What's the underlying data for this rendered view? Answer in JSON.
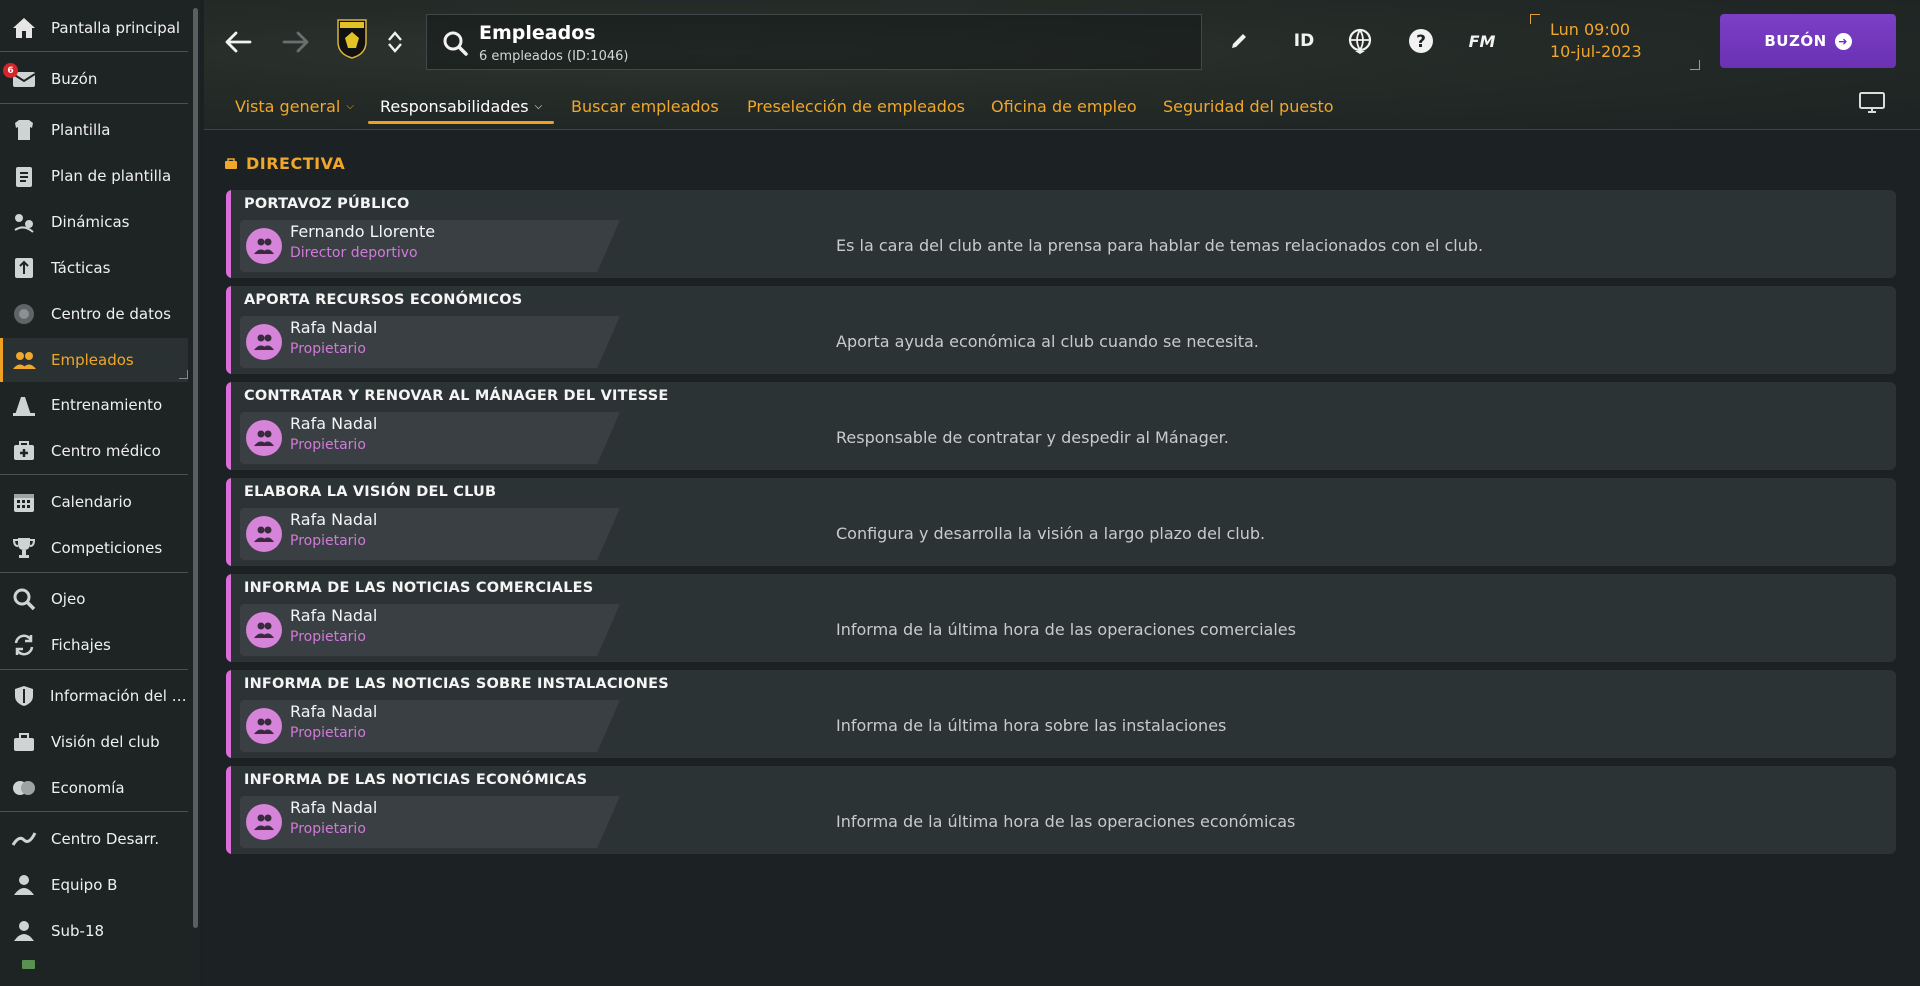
{
  "sidebar": {
    "items": [
      {
        "label": "Pantalla principal",
        "icon": "home-icon"
      },
      {
        "label": "Buzón",
        "icon": "inbox-icon",
        "badge": "6"
      },
      {
        "label": "Plantilla",
        "icon": "shirt-icon"
      },
      {
        "label": "Plan de plantilla",
        "icon": "clipboard-icon"
      },
      {
        "label": "Dinámicas",
        "icon": "dynamics-icon"
      },
      {
        "label": "Tácticas",
        "icon": "tactics-icon"
      },
      {
        "label": "Centro de datos",
        "icon": "data-center-icon"
      },
      {
        "label": "Empleados",
        "icon": "staff-icon"
      },
      {
        "label": "Entrenamiento",
        "icon": "training-icon"
      },
      {
        "label": "Centro médico",
        "icon": "medical-icon"
      },
      {
        "label": "Calendario",
        "icon": "calendar-icon"
      },
      {
        "label": "Competiciones",
        "icon": "trophy-icon"
      },
      {
        "label": "Ojeo",
        "icon": "scouting-icon"
      },
      {
        "label": "Fichajes",
        "icon": "transfers-icon"
      },
      {
        "label": "Información del club",
        "icon": "club-info-icon"
      },
      {
        "label": "Visión del club",
        "icon": "club-vision-icon"
      },
      {
        "label": "Economía",
        "icon": "finances-icon"
      },
      {
        "label": "Centro Desarr.",
        "icon": "development-icon"
      },
      {
        "label": "Equipo B",
        "icon": "b-team-icon"
      },
      {
        "label": "Sub-18",
        "icon": "u18-icon"
      }
    ]
  },
  "header": {
    "title": "Empleados",
    "subtitle": "6 empleados (ID:1046)",
    "id_label": "ID",
    "fm_label": "FM",
    "date_line1": "Lun 09:00",
    "date_line2": "10-jul-2023",
    "inbox_label": "BUZÓN",
    "tabs": [
      {
        "label": "Vista general",
        "dropdown": true
      },
      {
        "label": "Responsabilidades",
        "dropdown": true
      },
      {
        "label": "Buscar empleados"
      },
      {
        "label": "Preselección de empleados"
      },
      {
        "label": "Oficina de empleo"
      },
      {
        "label": "Seguridad del puesto"
      }
    ]
  },
  "main": {
    "section_title": "DIRECTIVA",
    "cards": [
      {
        "title": "PORTAVOZ PÚBLICO",
        "name": "Fernando Llorente",
        "role": "Director deportivo",
        "desc": "Es la cara del club ante la prensa para hablar de temas relacionados con el club."
      },
      {
        "title": "APORTA RECURSOS ECONÓMICOS",
        "name": "Rafa Nadal",
        "role": "Propietario",
        "desc": "Aporta ayuda económica al club cuando se necesita."
      },
      {
        "title": "CONTRATAR Y RENOVAR AL MÁNAGER DEL VITESSE",
        "name": "Rafa Nadal",
        "role": "Propietario",
        "desc": "Responsable de contratar y despedir al Mánager."
      },
      {
        "title": "ELABORA LA VISIÓN DEL CLUB",
        "name": "Rafa Nadal",
        "role": "Propietario",
        "desc": "Configura y desarrolla la visión a largo plazo del club."
      },
      {
        "title": "INFORMA DE LAS NOTICIAS COMERCIALES",
        "name": "Rafa Nadal",
        "role": "Propietario",
        "desc": "Informa de la última hora de las operaciones comerciales"
      },
      {
        "title": "INFORMA DE LAS NOTICIAS SOBRE INSTALACIONES",
        "name": "Rafa Nadal",
        "role": "Propietario",
        "desc": "Informa de la última hora sobre las instalaciones"
      },
      {
        "title": "INFORMA DE LAS NOTICIAS ECONÓMICAS",
        "name": "Rafa Nadal",
        "role": "Propietario",
        "desc": "Informa de la última hora de las operaciones económicas"
      }
    ]
  },
  "colors": {
    "accent": "#f0a72a",
    "inbox": "#7038bd",
    "card_stripe": "#d96ed9",
    "role": "#d27ad9"
  }
}
